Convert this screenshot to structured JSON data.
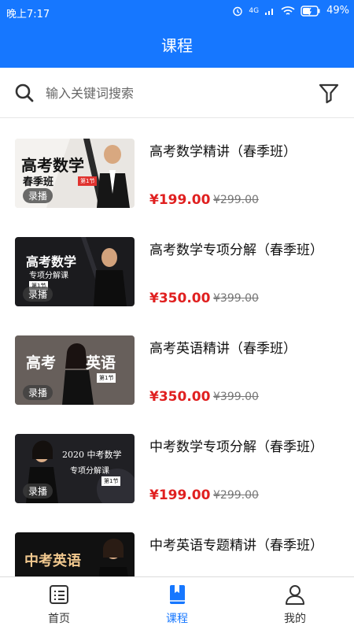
{
  "status_bar": {
    "time": "晚上7:17",
    "network": "4G",
    "battery": "49%"
  },
  "header": {
    "title": "课程"
  },
  "search": {
    "placeholder": "输入关键词搜索"
  },
  "courses": [
    {
      "title": "高考数学精讲（春季班）",
      "price": "¥199.00",
      "original_price": "¥299.00",
      "tag": "录播",
      "thumb_title": "高考数学",
      "thumb_sub": "春季班",
      "thumb_badge": "第1节"
    },
    {
      "title": "高考数学专项分解（春季班）",
      "price": "¥350.00",
      "original_price": "¥399.00",
      "tag": "录播",
      "thumb_title": "高考数学",
      "thumb_sub": "专项分解课",
      "thumb_badge": "第1节"
    },
    {
      "title": "高考英语精讲（春季班）",
      "price": "¥350.00",
      "original_price": "¥399.00",
      "tag": "录播",
      "thumb_title": "高考",
      "thumb_title2": "英语",
      "thumb_badge": "第1节"
    },
    {
      "title": "中考数学专项分解（春季班）",
      "price": "¥199.00",
      "original_price": "¥299.00",
      "tag": "录播",
      "thumb_title": "2020 中考数学",
      "thumb_sub": "专项分解课",
      "thumb_badge": "第1节"
    },
    {
      "title": "中考英语专题精讲（春季班）",
      "price": "",
      "original_price": "",
      "tag": "",
      "thumb_title": "中考英语"
    }
  ],
  "tabs": [
    {
      "label": "首页",
      "icon": "home-list-icon",
      "active": false
    },
    {
      "label": "课程",
      "icon": "book-icon",
      "active": true
    },
    {
      "label": "我的",
      "icon": "person-icon",
      "active": false
    }
  ],
  "colors": {
    "primary": "#1677ff",
    "price": "#e02020"
  }
}
